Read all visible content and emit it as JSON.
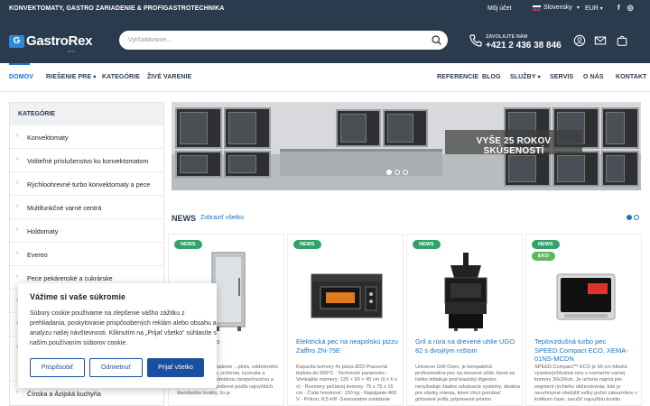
{
  "topbar": {
    "tagline": "KONVEKTOMATY, GASTRO ZARIADENIE & PROFIGASTROTECHNIKA",
    "account": "Môj účet",
    "language": "Slovensky",
    "currency": "EUR",
    "social": [
      "f",
      "◎"
    ]
  },
  "header": {
    "logo_text": "GastroRex",
    "logo_sub": "s.r.o.",
    "search_placeholder": "Vyhľadávanie...",
    "contact_label": "ZAVOLAJTE NÁM",
    "contact_phone": "+421 2 436 38 846",
    "icons": [
      "phone-icon",
      "user-icon",
      "mail-icon",
      "cart-icon"
    ]
  },
  "nav": {
    "left": [
      "DOMOV",
      "RIEŠENIE PRE",
      "KATEGÓRIE",
      "ŽIVÉ VARENIE"
    ],
    "right": [
      "REFERENCIE",
      "BLOG",
      "SLUŽBY",
      "SERVIS",
      "O NÁS",
      "KONTAKT"
    ]
  },
  "sidebar": {
    "title": "KATEGÓRIE",
    "items": [
      "Konvektomaty",
      "Voliteľné príslušenstvo ku konvektomatom",
      "Rýchloohrevné turbo konvektomaty a pece",
      "Multifunkčné varné centrá",
      "Holdomaty",
      "Evereo",
      "Pece pekárenské a cukrárske",
      "",
      "",
      "",
      "Čínska a Ázijská kuchyňa"
    ]
  },
  "banner": {
    "headline": "VYŠE 25 ROKOV SKÚSENOSTÍ",
    "slides": 3,
    "active_slide": 0
  },
  "news": {
    "title": "NEWS",
    "link": "Zobraziť všetko",
    "pages": 2,
    "active_page": 0,
    "cards": [
      {
        "badges": [
          "NEWS"
        ],
        "name": "...reň na cesto",
        "desc": "...atriPLANET je riadenie ...plota, oddeleného kysnutia, ...anenia, zníženie, kysnutia a ...bovaného s maximálnou bezpečnosťou a presnosťou. Sú vyrobené podľa najvyšších štandardov kvality, čo je"
      },
      {
        "badges": [
          "NEWS"
        ],
        "name": "Elektrická pec na neapolskú pizzu Zaffiro ZN-75E",
        "desc": "Kapacita komory 4x pizza Ø33 Pracovná teplota do 500°C . Technické parametre - Vonkajšie rozmery: 125 × 90 × 45 cm (š x h x v) - Rozmery pečiacej komory: 75 x 75 x 15 cm - Čistá hmotnosť: 150 kg - Napájanie:400 V - Príkon: 8,5 kW -Samostatné ovládanie"
      },
      {
        "badges": [
          "NEWS"
        ],
        "name": "Gril a rúra na drevené uhlie UGO 82 s dvojitým roštom",
        "desc": "Universo Grill Oven, je kompaktná profesionálna pec na drevené uhlie, ktorá sa ľahko inštaluje pod klasický digestor, nevyžaduje žiadne odsávacie systémy, ideálna pre všetky miesta, ktoré chcú ponúkať grilované jedlá, pripravené priamo"
      },
      {
        "badges": [
          "NEWS",
          "EKO"
        ],
        "name": "Teplovzdušná turbo pec SPEED.Compact ECO, XEMA-01NS-MCDN",
        "desc": "SPEED.Compact™ ECO je 60 cm hlboká vysokorýchlostná rúra s rozmermi varnej komory 30x30cm. Je určená najmä pre segment rýchleho občerstvenia, kde je nevyhnutné obslúžiť veľký počet zákazníkov v krátkom čase, zaručiť najvyššiu kvalitu"
      }
    ]
  },
  "cookie": {
    "title": "Vážime si vaše súkromie",
    "text": "Súbory cookie používame na zlepšenie vášho zážitku z prehliadania, poskytovanie prispôsobených reklám alebo obsahu a analýzu našej návštevnosti. Kliknutím na „Prijať všetko“ súhlasíte s naším používaním súborov cookie.",
    "buttons": [
      "Prispôsobiť",
      "Odmietnuť",
      "Prijať všetko"
    ]
  },
  "colors": {
    "header_bg": "#2a3b4d",
    "accent": "#1a73c5",
    "badge_green": "#2fa36b",
    "button_blue": "#1a4fa0"
  }
}
